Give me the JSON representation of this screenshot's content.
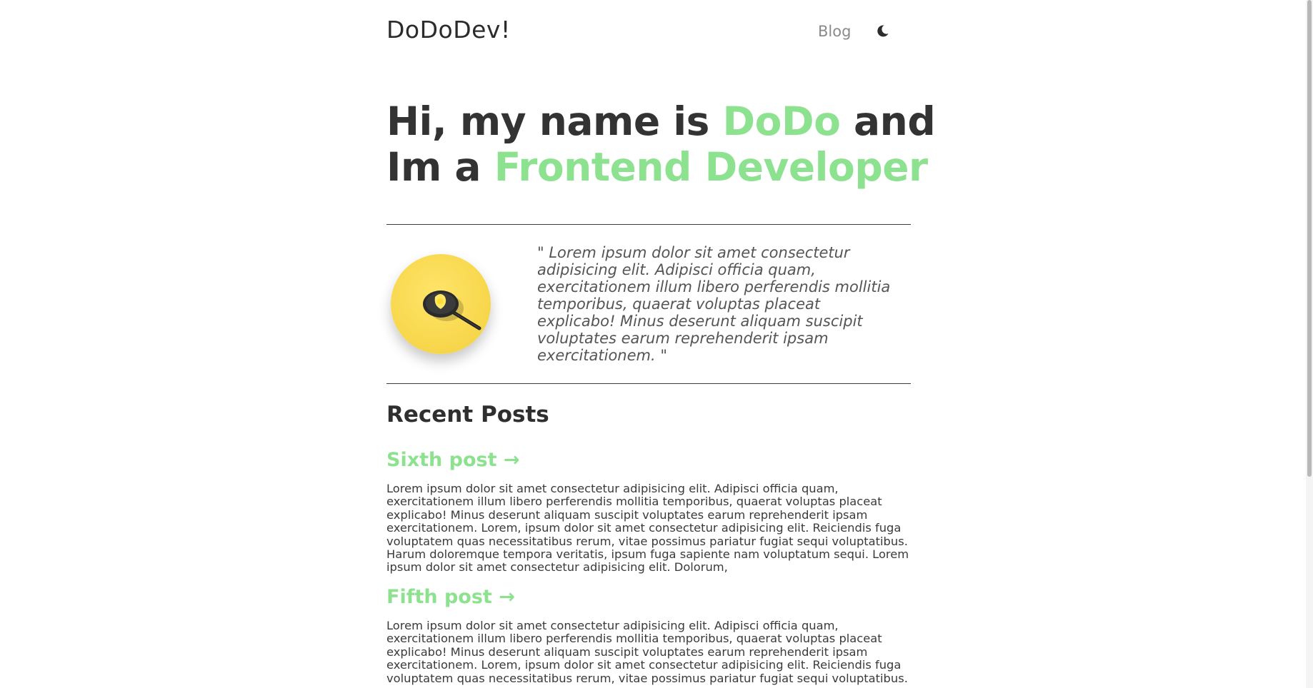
{
  "header": {
    "logo": "DoDoDev!",
    "nav_blog": "Blog",
    "theme_icon": "moon-icon"
  },
  "hero": {
    "line1_prefix": "Hi, my name is ",
    "name": "DoDo",
    "line1_suffix": " and",
    "line2_prefix": "Im a ",
    "role": "Frontend Developer"
  },
  "intro": {
    "avatar_icon": "frying-pan-egg-icon",
    "quote": "\" Lorem ipsum dolor sit amet consectetur adipisicing elit. Adipisci officia quam, exercitationem illum libero perferendis mollitia temporibus, quaerat voluptas placeat explicabo! Minus deserunt aliquam suscipit voluptates earum reprehenderit ipsam exercitationem. \""
  },
  "recent_posts": {
    "heading": "Recent Posts",
    "posts": [
      {
        "title": "Sixth post →",
        "excerpt": "Lorem ipsum dolor sit amet consectetur adipisicing elit. Adipisci officia quam, exercitationem illum libero perferendis mollitia temporibus, quaerat voluptas placeat explicabo! Minus deserunt aliquam suscipit voluptates earum reprehenderit ipsam exercitationem. Lorem, ipsum dolor sit amet consectetur adipisicing elit. Reiciendis fuga voluptatem quas necessitatibus rerum, vitae possimus pariatur fugiat sequi voluptatibus. Harum doloremque tempora veritatis, ipsum fuga sapiente nam voluptatum sequi. Lorem ipsum dolor sit amet consectetur adipisicing elit. Dolorum,"
      },
      {
        "title": "Fifth post →",
        "excerpt": "Lorem ipsum dolor sit amet consectetur adipisicing elit. Adipisci officia quam, exercitationem illum libero perferendis mollitia temporibus, quaerat voluptas placeat explicabo! Minus deserunt aliquam suscipit voluptates earum reprehenderit ipsam exercitationem. Lorem, ipsum dolor sit amet consectetur adipisicing elit. Reiciendis fuga voluptatem quas necessitatibus rerum, vitae possimus pariatur fugiat sequi voluptatibus."
      }
    ]
  },
  "colors": {
    "accent": "#8de28f",
    "text": "#333333",
    "avatar_bg": "#f8d84e"
  }
}
